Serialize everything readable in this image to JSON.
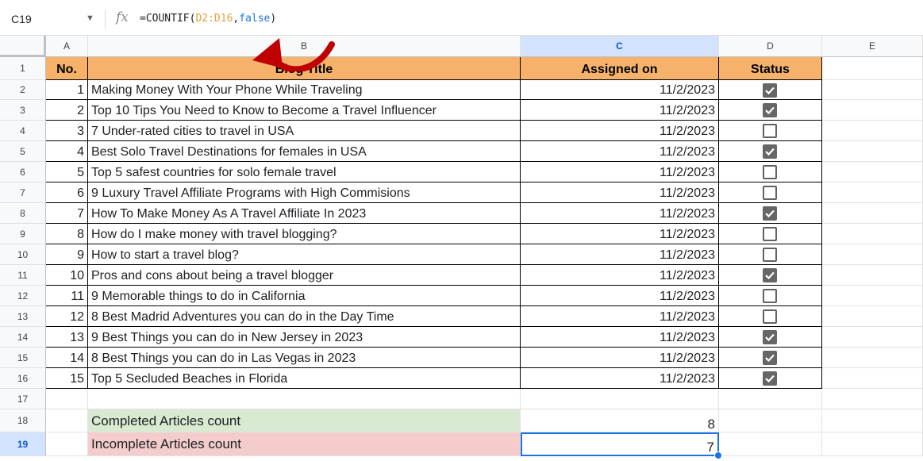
{
  "name_box": "C19",
  "formula": {
    "prefix": "=COUNTIF(",
    "ref": "D2:D16",
    "comma": ",",
    "arg": "false",
    "suffix": ")"
  },
  "columns": [
    "A",
    "B",
    "C",
    "D",
    "E"
  ],
  "row_numbers": [
    "1",
    "2",
    "3",
    "4",
    "5",
    "6",
    "7",
    "8",
    "9",
    "10",
    "11",
    "12",
    "13",
    "14",
    "15",
    "16",
    "17",
    "18",
    "19"
  ],
  "headers": {
    "no": "No.",
    "title": "Blog Title",
    "assigned": "Assigned on",
    "status": "Status"
  },
  "rows": [
    {
      "no": "1",
      "title": "Making Money With Your Phone While Traveling",
      "date": "11/2/2023",
      "done": true
    },
    {
      "no": "2",
      "title": "Top 10 Tips You Need to Know to Become a Travel Influencer",
      "date": "11/2/2023",
      "done": true
    },
    {
      "no": "3",
      "title": "7 Under-rated cities to travel in USA",
      "date": "11/2/2023",
      "done": false
    },
    {
      "no": "4",
      "title": "Best Solo Travel Destinations for females in USA",
      "date": "11/2/2023",
      "done": true
    },
    {
      "no": "5",
      "title": "Top 5 safest countries for solo female travel",
      "date": "11/2/2023",
      "done": false
    },
    {
      "no": "6",
      "title": "9 Luxury Travel Affiliate Programs with High Commisions",
      "date": "11/2/2023",
      "done": false
    },
    {
      "no": "7",
      "title": "How To Make Money As A Travel Affiliate In 2023",
      "date": "11/2/2023",
      "done": true
    },
    {
      "no": "8",
      "title": "How do I make money with travel blogging?",
      "date": "11/2/2023",
      "done": false
    },
    {
      "no": "9",
      "title": "How to start a travel blog?",
      "date": "11/2/2023",
      "done": false
    },
    {
      "no": "10",
      "title": "Pros and cons about being a travel blogger",
      "date": "11/2/2023",
      "done": true
    },
    {
      "no": "11",
      "title": "9 Memorable things to do in California",
      "date": "11/2/2023",
      "done": false
    },
    {
      "no": "12",
      "title": "8 Best Madrid Adventures you can do in the Day Time",
      "date": "11/2/2023",
      "done": false
    },
    {
      "no": "13",
      "title": "9 Best Things you can do in New Jersey in 2023",
      "date": "11/2/2023",
      "done": true
    },
    {
      "no": "14",
      "title": "8 Best Things you can do in Las Vegas in 2023",
      "date": "11/2/2023",
      "done": true
    },
    {
      "no": "15",
      "title": "Top 5 Secluded Beaches in Florida",
      "date": "11/2/2023",
      "done": true
    }
  ],
  "summary": [
    {
      "label": "Completed Articles count",
      "value": "8"
    },
    {
      "label": "Incomplete Articles count",
      "value": "7"
    }
  ],
  "colors": {
    "header_fill": "#f6b26b",
    "completed_fill": "#d9ead3",
    "incomplete_fill": "#f4cccc",
    "selection": "#1a73e8",
    "arrow": "#c00000"
  },
  "icons": {
    "fx": "fx-icon",
    "arrow": "red-curved-arrow-icon",
    "dropdown": "chevron-down-icon"
  }
}
